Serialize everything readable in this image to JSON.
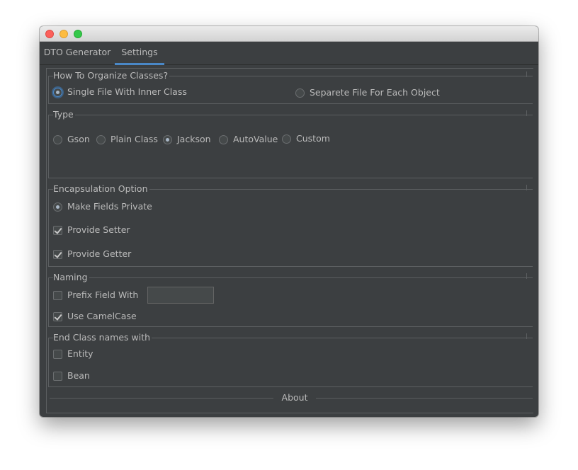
{
  "window": {
    "traffic_lights": [
      "close",
      "minimize",
      "maximize"
    ]
  },
  "tabs": [
    {
      "label": "DTO Generator",
      "active": false
    },
    {
      "label": "Settings",
      "active": true
    }
  ],
  "organize": {
    "legend": "How To Organize Classes?",
    "options": [
      {
        "label": "Single File With Inner Class",
        "selected": true
      },
      {
        "label": "Separete File For Each Object",
        "selected": false
      }
    ]
  },
  "type": {
    "legend": "Type",
    "options": [
      {
        "label": "Gson",
        "selected": false
      },
      {
        "label": "Plain Class",
        "selected": false
      },
      {
        "label": "Jackson",
        "selected": true
      },
      {
        "label": "AutoValue",
        "selected": false
      },
      {
        "label": "Custom",
        "selected": false
      }
    ]
  },
  "encapsulation": {
    "legend": "Encapsulation Option",
    "make_private": {
      "label": "Make Fields Private",
      "selected": true
    },
    "setter": {
      "label": "Provide Setter",
      "checked": true
    },
    "getter": {
      "label": "Provide Getter",
      "checked": true
    }
  },
  "naming": {
    "legend": "Naming",
    "prefix": {
      "label": "Prefix Field With",
      "checked": false,
      "value": ""
    },
    "camelcase": {
      "label": "Use CamelCase",
      "checked": true
    }
  },
  "suffix": {
    "legend": "End Class names with",
    "entity": {
      "label": "Entity",
      "checked": false
    },
    "bean": {
      "label": "Bean",
      "checked": false
    }
  },
  "about": {
    "label": "About"
  },
  "colors": {
    "background": "#3c3f41",
    "accent": "#4a88c7",
    "text": "#bbbbbb"
  }
}
